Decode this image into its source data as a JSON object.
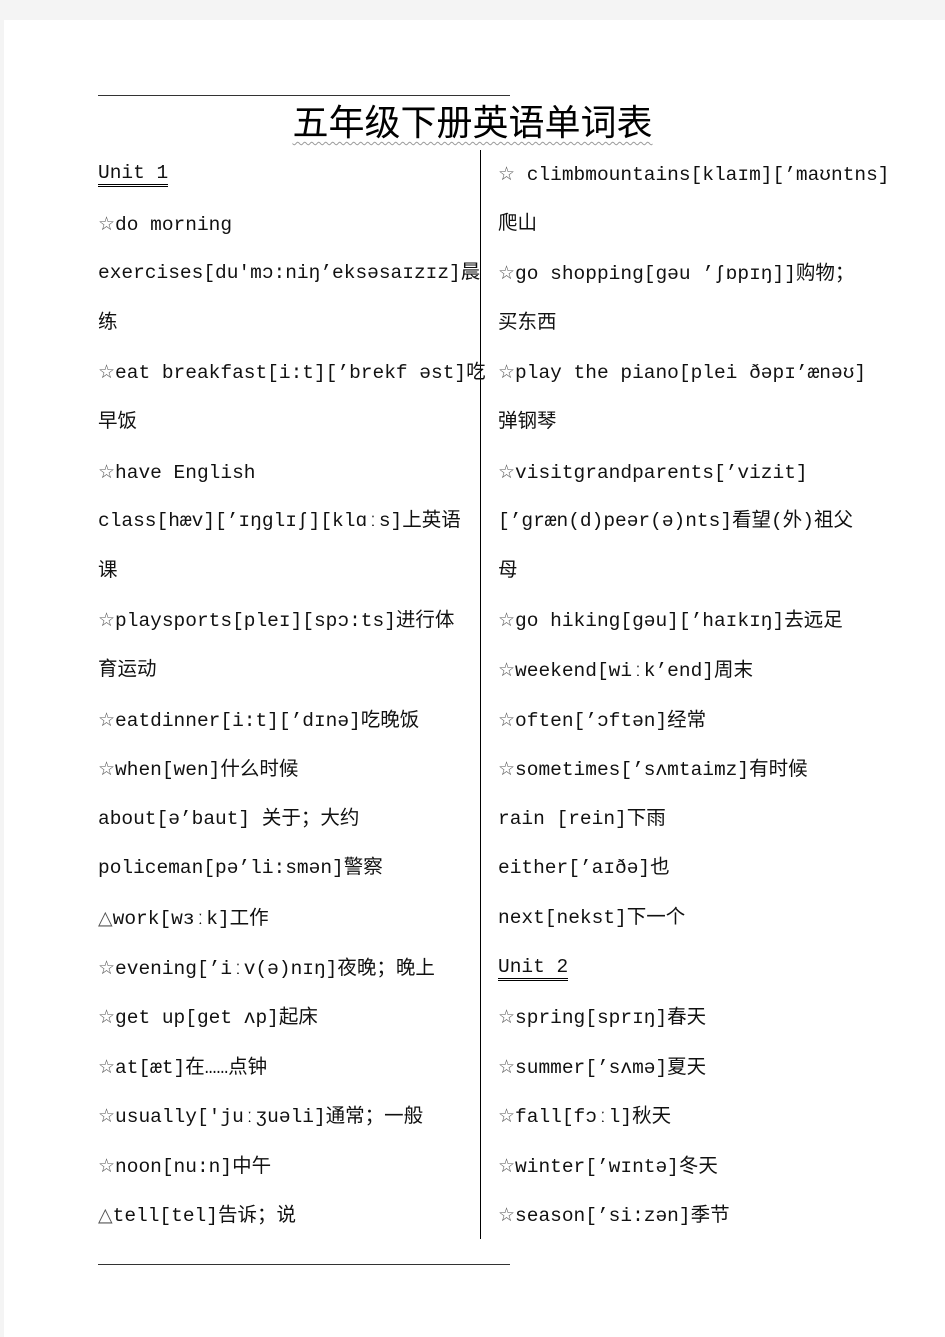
{
  "document": {
    "title": "五年级下册英语单词表"
  },
  "left_column": {
    "lines": [
      {
        "type": "unit",
        "text": "Unit 1"
      },
      {
        "type": "entry",
        "marker": "☆",
        "text": "do morning"
      },
      {
        "type": "text",
        "marker": "",
        "text": "exercises[du'mɔ:niŋ’eksəsaɪzɪz]晨"
      },
      {
        "type": "text",
        "marker": "",
        "text": "练"
      },
      {
        "type": "entry",
        "marker": "☆",
        "text": "eat breakfast[i:t][’brekf əst]吃"
      },
      {
        "type": "text",
        "marker": "",
        "text": "早饭"
      },
      {
        "type": "entry",
        "marker": "☆",
        "text": "have English"
      },
      {
        "type": "text",
        "marker": "",
        "text": "class[hæv][’ɪŋglɪʃ][klɑːs]上英语"
      },
      {
        "type": "text",
        "marker": "",
        "text": "课"
      },
      {
        "type": "entry",
        "marker": "☆",
        "text": "playsports[pleɪ][spɔ:ts]进行体"
      },
      {
        "type": "text",
        "marker": "",
        "text": "育运动"
      },
      {
        "type": "entry",
        "marker": "☆",
        "text": "eatdinner[i:t][’dɪnə]吃晚饭"
      },
      {
        "type": "entry",
        "marker": "☆",
        "text": "when[wen]什么时候"
      },
      {
        "type": "text",
        "marker": "",
        "text": "about[ə’baut] 关于；大约"
      },
      {
        "type": "text",
        "marker": "",
        "text": "policeman[pə’li:smən]警察"
      },
      {
        "type": "entry",
        "marker": "△",
        "text": "work[wɜːk]工作"
      },
      {
        "type": "entry",
        "marker": "☆",
        "text": "evening[’iːv(ə)nɪŋ]夜晚；晚上"
      },
      {
        "type": "entry",
        "marker": "☆",
        "text": "get up[get ʌp]起床"
      },
      {
        "type": "entry",
        "marker": "☆",
        "text": "at[æt]在……点钟"
      },
      {
        "type": "entry",
        "marker": "☆",
        "text": "usually['juːʒuəli]通常；一般"
      },
      {
        "type": "entry",
        "marker": "☆",
        "text": "noon[nu:n]中午"
      },
      {
        "type": "entry",
        "marker": "△",
        "text": "tell[tel]告诉；说"
      }
    ]
  },
  "right_column": {
    "lines": [
      {
        "type": "entry",
        "marker": "☆",
        "text": " climbmountains[klaɪm][’maʊntns]"
      },
      {
        "type": "text",
        "marker": "",
        "text": "爬山"
      },
      {
        "type": "entry",
        "marker": "☆",
        "text": "go shopping[gəu ’ʃɒpɪŋ]]购物；"
      },
      {
        "type": "text",
        "marker": "",
        "text": "买东西"
      },
      {
        "type": "entry",
        "marker": "☆",
        "text": "play the piano[plei ðəpɪ’ænəʊ]"
      },
      {
        "type": "text",
        "marker": "",
        "text": "弹钢琴"
      },
      {
        "type": "entry",
        "marker": "☆",
        "text": "visitgrandparents[’vizit]"
      },
      {
        "type": "text",
        "marker": "",
        "text": "[’græn(d)peər(ə)nts]看望(外)祖父"
      },
      {
        "type": "text",
        "marker": "",
        "text": "母"
      },
      {
        "type": "entry",
        "marker": "☆",
        "text": "go hiking[gəu][’haɪkɪŋ]去远足"
      },
      {
        "type": "entry",
        "marker": "☆",
        "text": "weekend[wiːk’end]周末"
      },
      {
        "type": "entry",
        "marker": "☆",
        "text": "often[’ɔftən]经常"
      },
      {
        "type": "entry",
        "marker": "☆",
        "text": "sometimes[’sʌmtaimz]有时候"
      },
      {
        "type": "text",
        "marker": "",
        "text": "rain [rein]下雨"
      },
      {
        "type": "text",
        "marker": "",
        "text": "either[’aɪðə]也"
      },
      {
        "type": "text",
        "marker": "",
        "text": "next[nekst]下一个"
      },
      {
        "type": "unit",
        "text": "Unit 2"
      },
      {
        "type": "entry",
        "marker": "☆",
        "text": "spring[sprɪŋ]春天"
      },
      {
        "type": "entry",
        "marker": "☆",
        "text": "summer[’sʌmə]夏天"
      },
      {
        "type": "entry",
        "marker": "☆",
        "text": "fall[fɔːl]秋天"
      },
      {
        "type": "entry",
        "marker": "☆",
        "text": "winter[’wɪntə]冬天"
      },
      {
        "type": "entry",
        "marker": "☆",
        "text": "season[’si:zən]季节"
      }
    ]
  }
}
